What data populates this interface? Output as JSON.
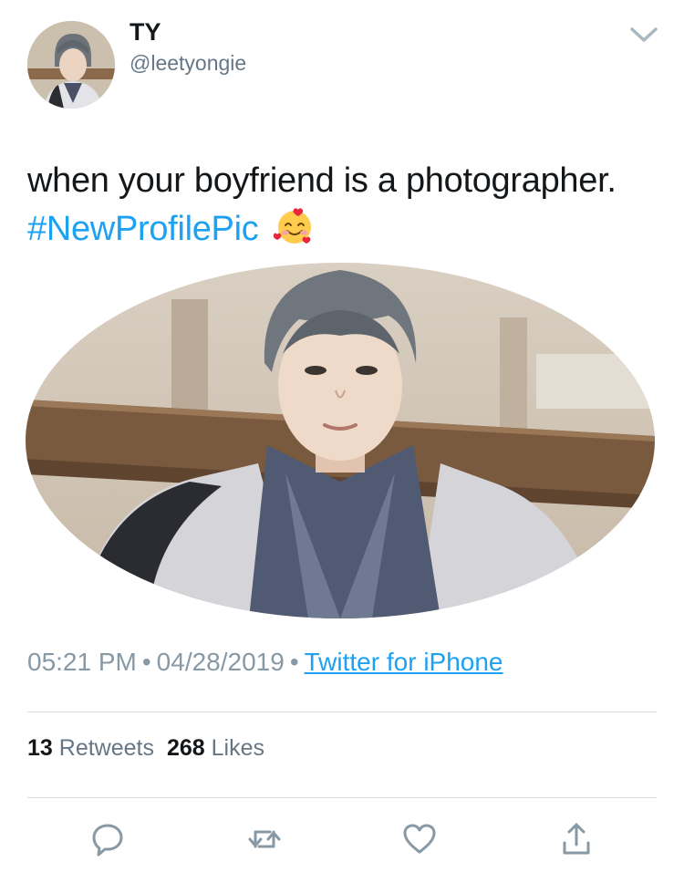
{
  "tweet": {
    "display_name": "TY",
    "handle": "@leetyongie",
    "text_main": "when your boyfriend is a photographer.",
    "hashtag": "#NewProfilePic",
    "emoji": "smiling-face-with-hearts-icon",
    "time": "05:21 PM",
    "date": "04/28/2019",
    "separator": "•",
    "source": "Twitter for iPhone"
  },
  "stats": {
    "retweets_count": "13",
    "retweets_label": "Retweets",
    "likes_count": "268",
    "likes_label": "Likes"
  },
  "icons": {
    "more": "chevron-down-icon",
    "reply": "reply-icon",
    "retweet": "retweet-icon",
    "like": "heart-icon",
    "share": "share-icon"
  },
  "colors": {
    "accent": "#1da1f2",
    "text": "#14171a",
    "secondary": "#657786",
    "icon": "#8899a6",
    "divider": "#d8dde1"
  }
}
